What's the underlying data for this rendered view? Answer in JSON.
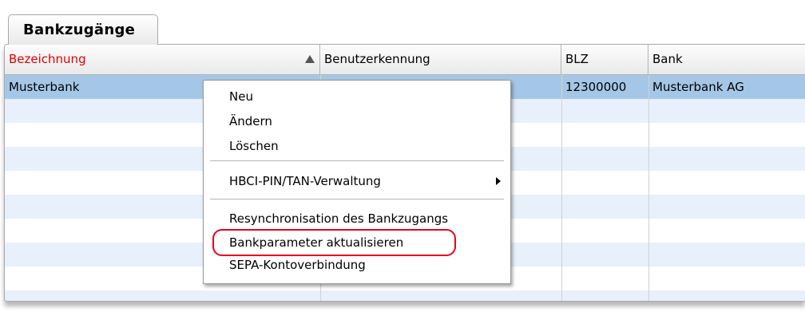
{
  "tab": {
    "label": "Bankzugänge"
  },
  "table": {
    "columns": [
      {
        "label": "Bezeichnung",
        "sorted": "ascending",
        "color": "#e00000"
      },
      {
        "label": "Benutzerkennung"
      },
      {
        "label": "BLZ"
      },
      {
        "label": "Bank"
      }
    ],
    "rows": [
      {
        "bezeichnung": "Musterbank",
        "benutzerkennung": "",
        "blz": "12300000",
        "bank": "Musterbank AG",
        "selected": true
      }
    ],
    "selection_color": "#a5c7e7",
    "stripe_color": "#e7f0fb"
  },
  "context_menu": {
    "items": [
      {
        "label": "Neu"
      },
      {
        "label": "Ändern"
      },
      {
        "label": "Löschen"
      },
      {
        "label": "HBCI-PIN/TAN-Verwaltung",
        "submenu": true
      },
      {
        "label": "Resynchronisation des Bankzugangs"
      },
      {
        "label": "Bankparameter aktualisieren",
        "highlighted": true
      },
      {
        "label": "SEPA-Kontoverbindung"
      }
    ],
    "highlight_color": "#e8001a"
  }
}
